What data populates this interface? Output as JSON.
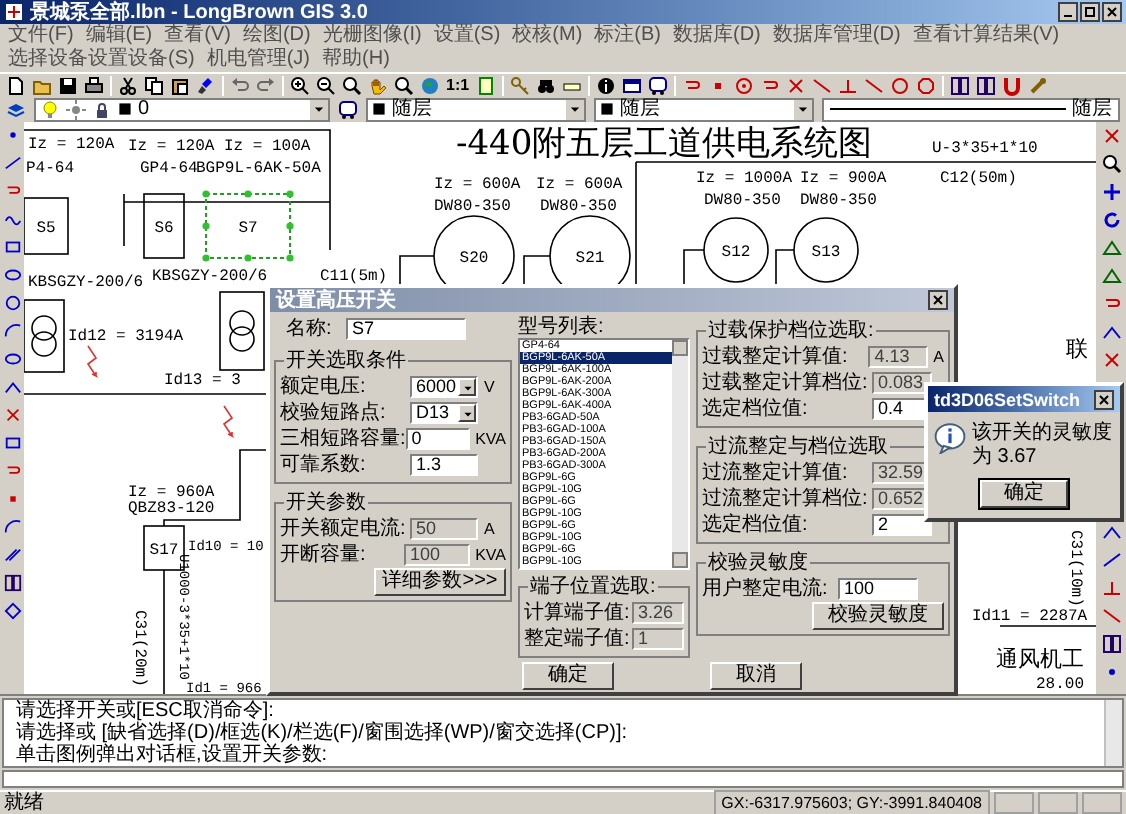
{
  "window": {
    "title": "景城泵全部.lbn - LongBrown GIS 3.0"
  },
  "menu": [
    "文件(F)",
    "编辑(E)",
    "查看(V)",
    "绘图(D)",
    "光栅图像(I)",
    "设置(S)",
    "校核(M)",
    "标注(B)",
    "数据库(D)",
    "数据库管理(D)",
    "查看计算结果(V)",
    "选择设备设置设备(S)",
    "机电管理(J)",
    "帮助(H)"
  ],
  "toolbar": {
    "ratio_button": "1:1"
  },
  "layer_bar": {
    "layer": "0",
    "color_setting": "随层",
    "linetype": "随层",
    "lineweight": "随层"
  },
  "drawing": {
    "title": "-440附五层工道供电系统图",
    "switches": [
      {
        "label": "S5",
        "selected": false
      },
      {
        "label": "S6",
        "selected": false
      },
      {
        "label": "S7",
        "selected": true
      },
      {
        "label": "S17",
        "selected": false
      }
    ],
    "breakers": [
      "S20",
      "S21",
      "S12",
      "S13"
    ],
    "labels": [
      "Iz = 120A",
      "P4-64",
      "Iz = 120A",
      "Iz = 100A",
      "GP4-64",
      "BGP9L-6AK-50A",
      "KBSGZY-200/6",
      "KBSGZY-200/6",
      "Id12 = 3194A",
      "Id13 = 3",
      "Iz = 600A",
      "DW80-350",
      "Iz = 600A",
      "DW80-350",
      "C11(5m)",
      "Iz = 1000A",
      "DW80-350",
      "Iz = 900A",
      "DW80-350",
      "U-3*35+1*10",
      "C12(50m)",
      "Iz = 960A",
      "QBZ83-120",
      "Id10 = 10",
      "C31(20m)",
      "U1000-3*35+1*10",
      "Id1 = 966",
      "联",
      "C31(10m)",
      "Id11 = 2287A",
      "通风机工",
      "28.00"
    ]
  },
  "dialog": {
    "title": "设置高压开关",
    "name": {
      "label": "名称:",
      "value": "S7"
    },
    "selection_group": {
      "title": "开关选取条件",
      "fields": [
        {
          "label": "额定电压:",
          "value": "6000",
          "unit": "V",
          "kind": "dropdown",
          "disabled": false
        },
        {
          "label": "校验短路点:",
          "value": "D13",
          "kind": "dropdown",
          "disabled": false
        },
        {
          "label": "三相短路容量:",
          "value": "0",
          "unit": "KVA",
          "kind": "input",
          "disabled": false
        },
        {
          "label": "可靠系数:",
          "value": "1.3",
          "kind": "input",
          "disabled": false
        }
      ]
    },
    "params_group": {
      "title": "开关参数",
      "fields": [
        {
          "label": "开关额定电流:",
          "value": "50",
          "unit": "A",
          "kind": "input",
          "disabled": true
        },
        {
          "label": "开断容量:",
          "value": "100",
          "unit": "KVA",
          "kind": "input",
          "disabled": true
        }
      ],
      "button": "详细参数>>>"
    },
    "model_list": {
      "label": "型号列表:",
      "items": [
        {
          "text": "GP4-64",
          "selected": false
        },
        {
          "text": "BGP9L-6AK-50A",
          "selected": true
        },
        {
          "text": "BGP9L-6AK-100A",
          "selected": false
        },
        {
          "text": "BGP9L-6AK-200A",
          "selected": false
        },
        {
          "text": "BGP9L-6AK-300A",
          "selected": false
        },
        {
          "text": "BGP9L-6AK-400A",
          "selected": false
        },
        {
          "text": "PB3-6GAD-50A",
          "selected": false
        },
        {
          "text": "PB3-6GAD-100A",
          "selected": false
        },
        {
          "text": "PB3-6GAD-150A",
          "selected": false
        },
        {
          "text": "PB3-6GAD-200A",
          "selected": false
        },
        {
          "text": "PB3-6GAD-300A",
          "selected": false
        },
        {
          "text": "BGP9L-6G",
          "selected": false
        },
        {
          "text": "BGP9L-10G",
          "selected": false
        },
        {
          "text": "BGP9L-6G",
          "selected": false
        },
        {
          "text": "BGP9L-10G",
          "selected": false
        },
        {
          "text": "BGP9L-6G",
          "selected": false
        },
        {
          "text": "BGP9L-10G",
          "selected": false
        },
        {
          "text": "BGP9L-6G",
          "selected": false
        },
        {
          "text": "BGP9L-10G",
          "selected": false
        }
      ]
    },
    "terminal_group": {
      "title": "端子位置选取:",
      "fields": [
        {
          "label": "计算端子值:",
          "value": "3.26",
          "kind": "input",
          "disabled": true
        },
        {
          "label": "整定端子值:",
          "value": "1",
          "kind": "input",
          "disabled": true
        }
      ]
    },
    "overload_group": {
      "title": "过载保护档位选取:",
      "fields": [
        {
          "label": "过载整定计算值:",
          "value": "4.13",
          "unit": "A",
          "kind": "input",
          "disabled": true
        },
        {
          "label": "过载整定计算档位:",
          "value": "0.083",
          "kind": "input",
          "disabled": true
        },
        {
          "label": "选定档位值:",
          "value": "0.4",
          "kind": "input",
          "disabled": false
        }
      ]
    },
    "overcurrent_group": {
      "title": "过流整定与档位选取",
      "fields": [
        {
          "label": "过流整定计算值:",
          "value": "32.59",
          "kind": "input",
          "disabled": true
        },
        {
          "label": "过流整定计算档位:",
          "value": "0.652",
          "kind": "input",
          "disabled": true
        },
        {
          "label": "选定档位值:",
          "value": "2",
          "kind": "input",
          "disabled": false
        }
      ]
    },
    "sensitivity_group": {
      "title": "校验灵敏度",
      "fields": [
        {
          "label": "用户整定电流:",
          "value": "100",
          "kind": "input",
          "disabled": false
        }
      ],
      "button": "校验灵敏度"
    },
    "buttons": [
      "确定",
      "取消"
    ]
  },
  "message_box": {
    "title": "td3D06SetSwitch",
    "message": "该开关的灵敏度为 3.67",
    "button": "确定"
  },
  "command_lines": [
    "请选择开关或[ESC取消命令]:",
    "请选择或 [缺省选择(D)/框选(K)/栏选(F)/窗围选择(WP)/窗交选择(CP)]:",
    "单击图例弹出对话框,设置开关参数:"
  ],
  "status_bar": {
    "message": "就绪",
    "coordinates": "GX:-6317.975603; GY:-3991.840408"
  }
}
